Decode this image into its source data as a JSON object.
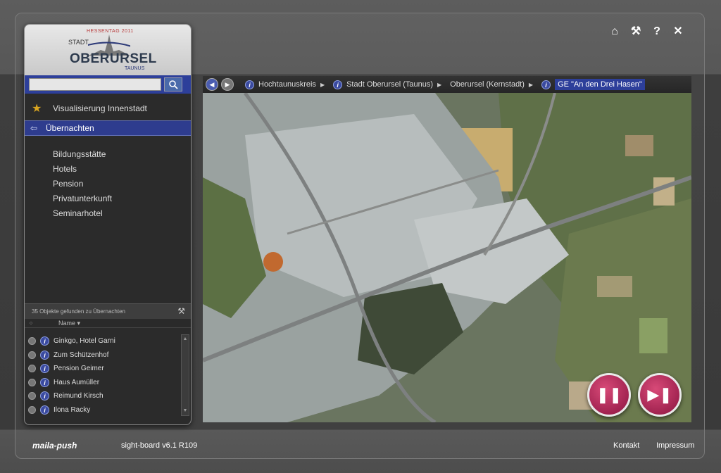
{
  "top_icons": [
    {
      "name": "home-icon",
      "glyph": "⌂"
    },
    {
      "name": "wrench-icon",
      "glyph": "⚒"
    },
    {
      "name": "help-icon",
      "glyph": "?"
    },
    {
      "name": "close-icon",
      "glyph": "✕"
    }
  ],
  "logo": {
    "event": "HESSENTAG 2011",
    "prefix": "STADT",
    "name": "OBERURSEL",
    "suffix": "TAUNUS"
  },
  "search": {
    "value": "",
    "placeholder": ""
  },
  "menu": {
    "favorite": "Visualisierung Innenstadt",
    "active": "Übernachten",
    "subcategories": [
      "Bildungsstätte",
      "Hotels",
      "Pension",
      "Privatunterkunft",
      "Seminarhotel"
    ]
  },
  "results": {
    "summary": "35 Objekte gefunden zu Übernachten",
    "column": "Name",
    "items": [
      "Ginkgo, Hotel Garni",
      "Zum Schützenhof",
      "Pension Geimer",
      "Haus Aumüller",
      "Reimund Kirsch",
      "Ilona Racky"
    ]
  },
  "breadcrumb": [
    "Hochtaunuskreis",
    "Stadt Oberursel (Taunus)",
    "Oberursel (Kernstadt)",
    "GE \"An den Drei Hasen\""
  ],
  "footer": {
    "brand": "maila-push",
    "version": "sight-board v6.1 R109",
    "contact": "Kontakt",
    "imprint": "Impressum"
  }
}
